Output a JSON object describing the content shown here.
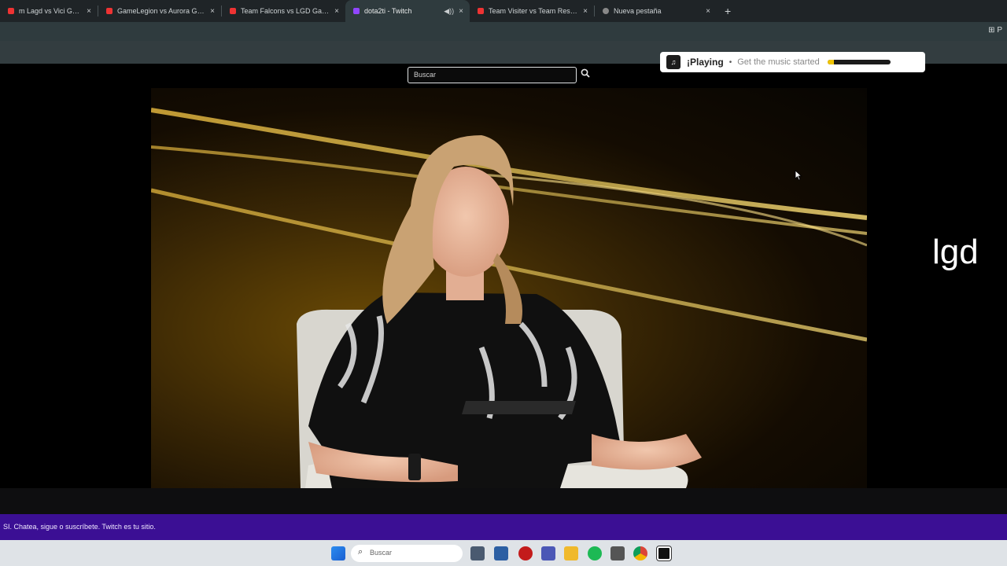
{
  "browser": {
    "tabs": [
      {
        "title": "m Lagd vs Vici Gaming - Y",
        "favicon_color": "#e33"
      },
      {
        "title": "GameLegion vs Aurora Gamin",
        "favicon_color": "#e33"
      },
      {
        "title": "Team Falcons vs LGD Gaming -",
        "favicon_color": "#e33"
      },
      {
        "title": "dota2ti - Twitch",
        "favicon_color": "#9146ff",
        "active": true
      },
      {
        "title": "Team Visiter vs Team Resilienc",
        "favicon_color": "#e33"
      },
      {
        "title": "Nueva pestaña",
        "favicon_color": "#888"
      }
    ],
    "new_tab_symbol": "+",
    "close_symbol": "×",
    "extension_label": "⊞ P"
  },
  "search": {
    "placeholder": "Buscar",
    "icon": "search-icon"
  },
  "now_playing": {
    "title": "¡Playing",
    "dot": "•",
    "subtitle": "Get the music started",
    "progress": 0.1
  },
  "side_label": "lgd",
  "banner_text": "SI. Chatea, sigue o suscríbete. Twitch es tu sitio.",
  "taskbar": {
    "search_placeholder": "Buscar",
    "icons": [
      "windows-icon",
      "file-explorer-icon",
      "monitor-icon",
      "record-icon",
      "teams-icon",
      "folder-icon",
      "spotify-icon",
      "chrome-icon",
      "chrome-icon",
      "app-icon"
    ]
  }
}
